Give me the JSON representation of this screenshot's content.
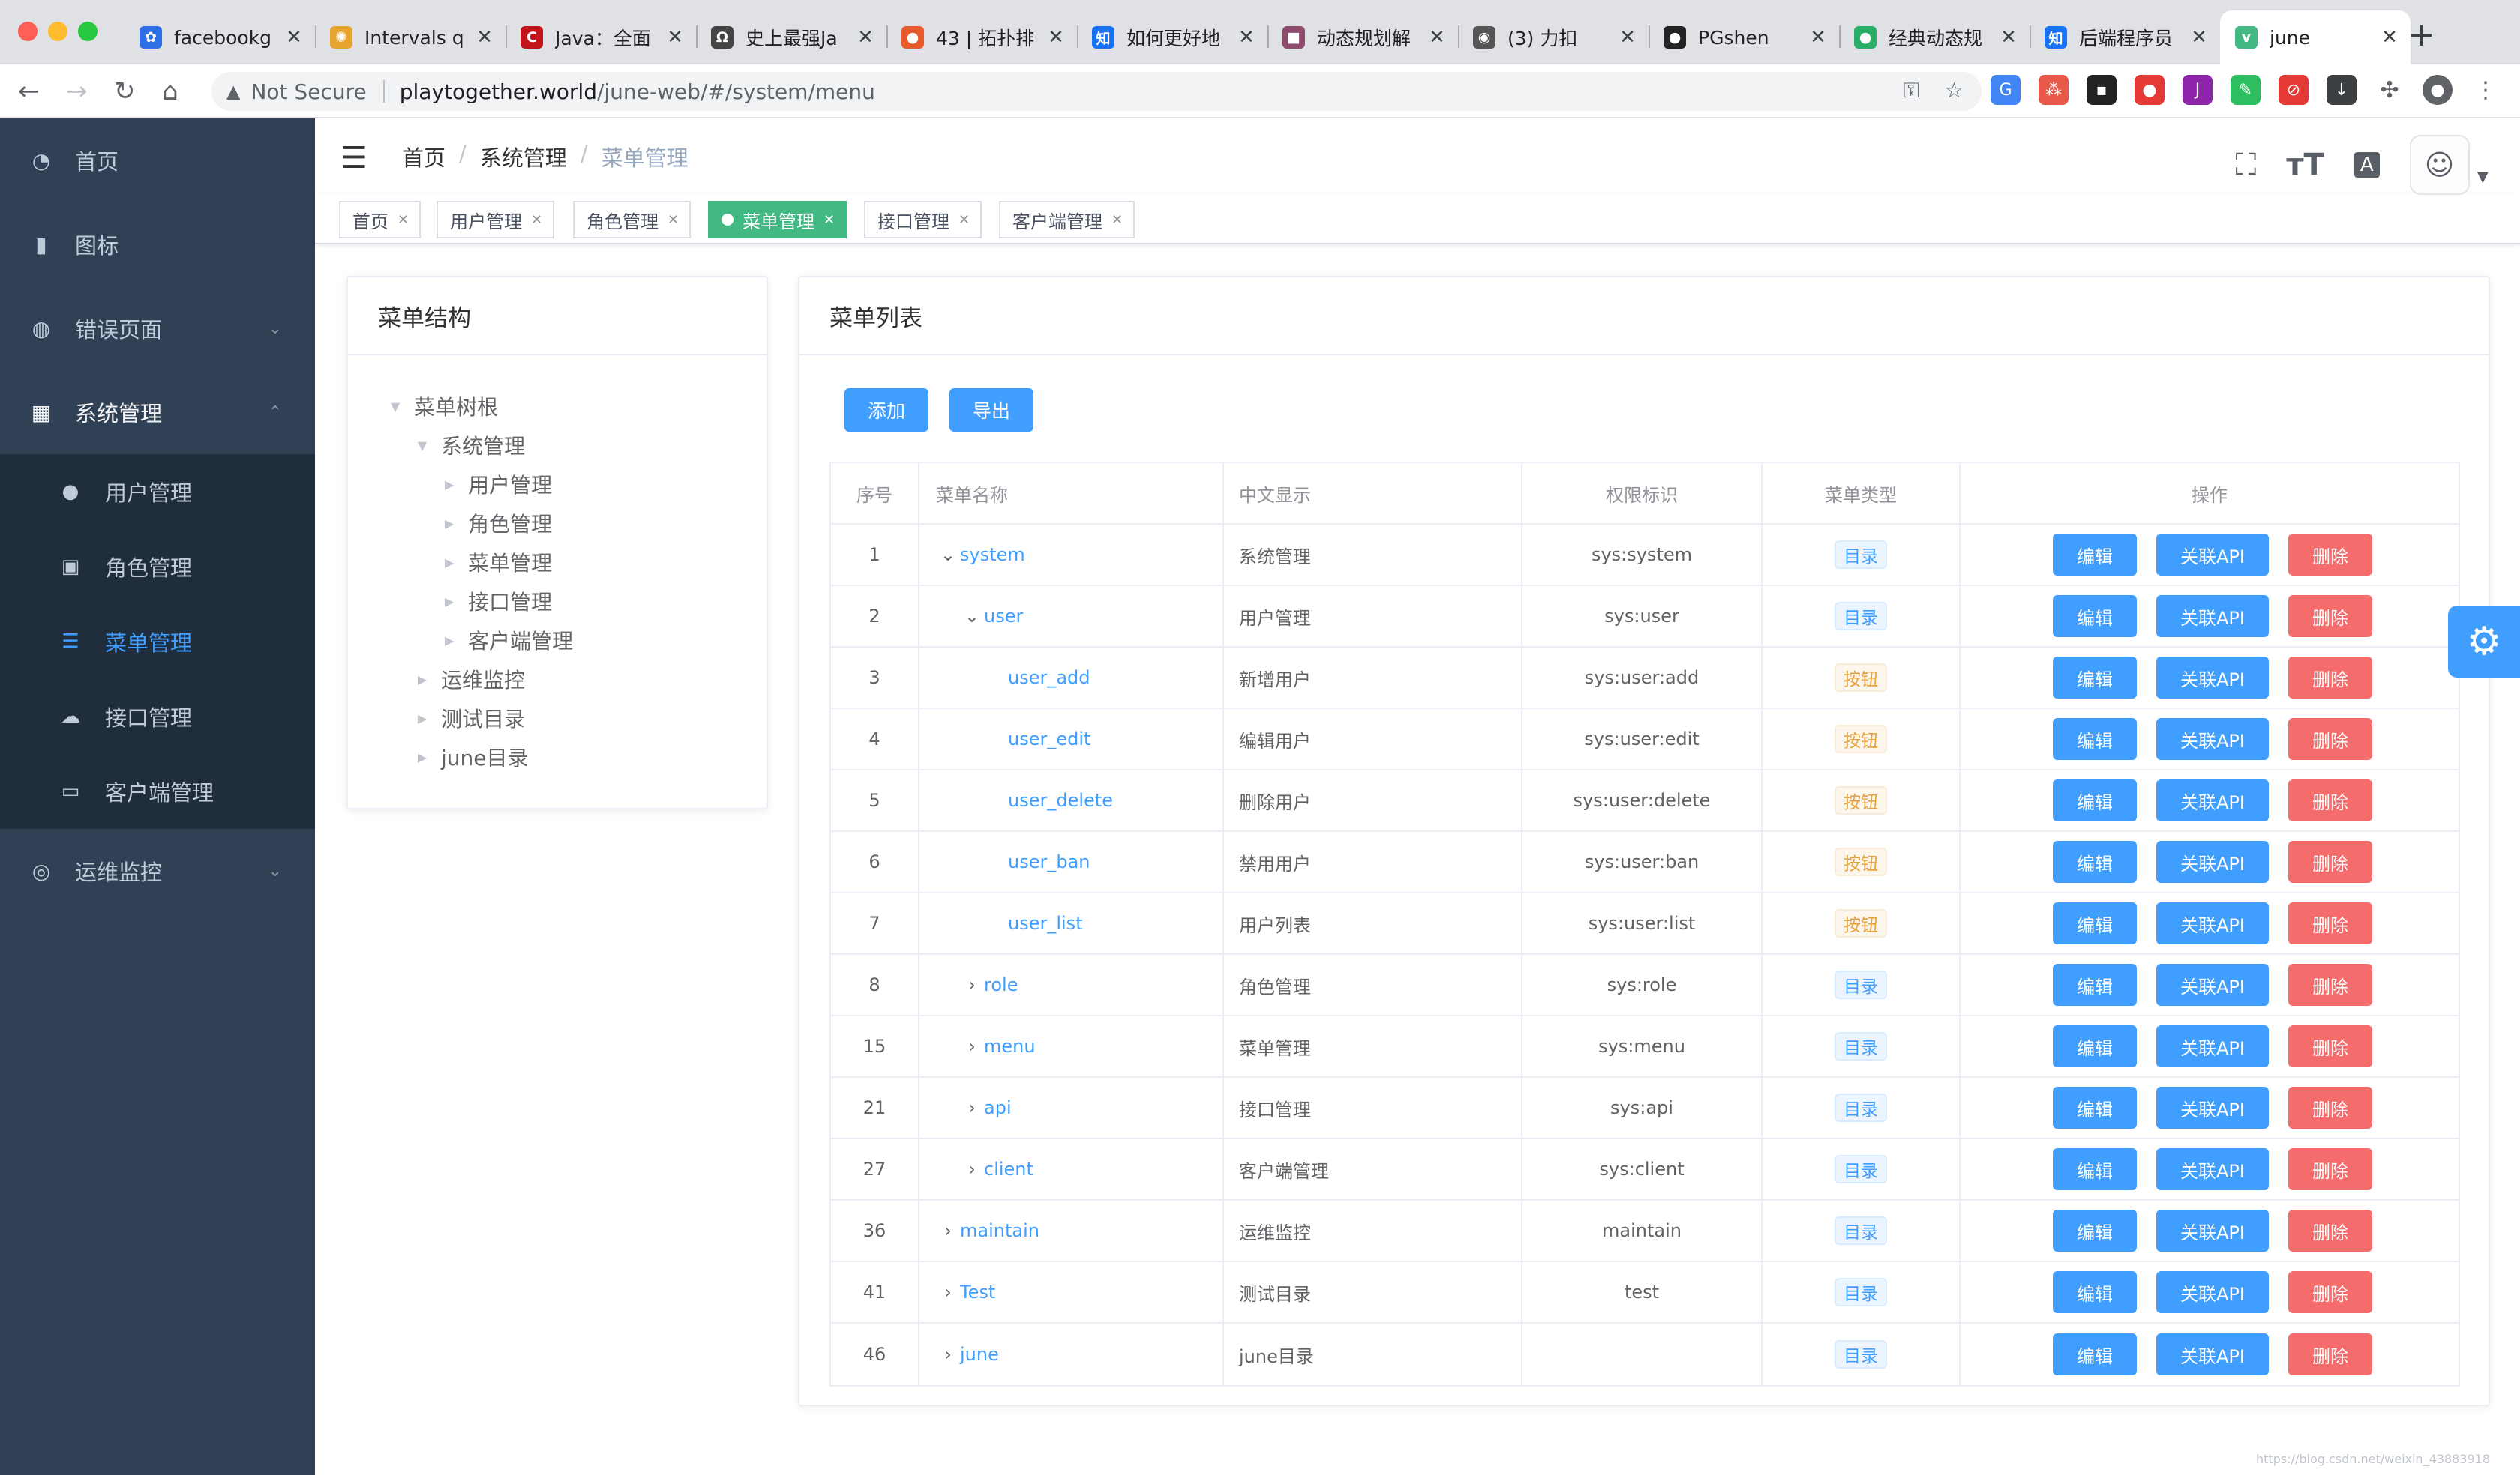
{
  "browser": {
    "tabs": [
      {
        "title": "facebookg",
        "icon": "paw-icon",
        "color": "#2f6fe4",
        "glyph": "✿"
      },
      {
        "title": "Intervals q",
        "icon": "sheets-icon",
        "color": "#e8a430",
        "glyph": "✺"
      },
      {
        "title": "Java：全面",
        "icon": "c-icon",
        "color": "#c4141b",
        "glyph": "C"
      },
      {
        "title": "史上最强Ja",
        "icon": "omega-icon",
        "color": "#444444",
        "glyph": "Ω"
      },
      {
        "title": "43 | 拓扑排",
        "icon": "geek-icon",
        "color": "#e85a2a",
        "glyph": "●"
      },
      {
        "title": "如何更好地",
        "icon": "zhihu-icon",
        "color": "#1772f6",
        "glyph": "知"
      },
      {
        "title": "动态规划解",
        "icon": "image-icon",
        "color": "#8e4a6b",
        "glyph": "■"
      },
      {
        "title": "(3) 力扣",
        "icon": "globe-icon",
        "color": "#555555",
        "glyph": "◉"
      },
      {
        "title": "PGshen",
        "icon": "github-icon",
        "color": "#222222",
        "glyph": "●"
      },
      {
        "title": "经典动态规",
        "icon": "wechat-icon",
        "color": "#2aae67",
        "glyph": "●"
      },
      {
        "title": "后端程序员",
        "icon": "zhihu-icon",
        "color": "#1772f6",
        "glyph": "知"
      },
      {
        "title": "june",
        "icon": "vue-icon",
        "color": "#42b983",
        "glyph": "v"
      }
    ],
    "not_secure": "Not Secure",
    "url_host": "playtogether.world",
    "url_path": "/june-web/#/system/menu"
  },
  "sidebar": {
    "items": [
      {
        "label": "首页",
        "icon": "dashboard-icon",
        "glyph": "◔"
      },
      {
        "label": "图标",
        "icon": "icon-icon",
        "glyph": "▮"
      },
      {
        "label": "错误页面",
        "icon": "bug-icon",
        "glyph": "◍",
        "arrow": "⌄"
      },
      {
        "label": "系统管理",
        "icon": "grid-icon",
        "glyph": "▦",
        "arrow": "⌃"
      }
    ],
    "sub_items": [
      {
        "label": "用户管理",
        "icon": "user-icon",
        "glyph": "●"
      },
      {
        "label": "角色管理",
        "icon": "role-icon",
        "glyph": "▣"
      },
      {
        "label": "菜单管理",
        "icon": "menu-icon",
        "glyph": "☰"
      },
      {
        "label": "接口管理",
        "icon": "cloud-icon",
        "glyph": "☁"
      },
      {
        "label": "客户端管理",
        "icon": "monitor-icon",
        "glyph": "▭"
      }
    ],
    "bottom_item": {
      "label": "运维监控",
      "icon": "lifebuoy-icon",
      "glyph": "◎",
      "arrow": "⌄"
    }
  },
  "header": {
    "breadcrumb": [
      "首页",
      "系统管理",
      "菜单管理"
    ]
  },
  "tagsview": [
    {
      "label": "首页",
      "active": false
    },
    {
      "label": "用户管理",
      "active": false
    },
    {
      "label": "角色管理",
      "active": false
    },
    {
      "label": "菜单管理",
      "active": true
    },
    {
      "label": "接口管理",
      "active": false
    },
    {
      "label": "客户端管理",
      "active": false
    }
  ],
  "tree_card": {
    "title": "菜单结构",
    "nodes": [
      {
        "label": "菜单树根",
        "level": 0,
        "expanded": true
      },
      {
        "label": "系统管理",
        "level": 1,
        "expanded": true
      },
      {
        "label": "用户管理",
        "level": 2,
        "expanded": false
      },
      {
        "label": "角色管理",
        "level": 2,
        "expanded": false
      },
      {
        "label": "菜单管理",
        "level": 2,
        "expanded": false
      },
      {
        "label": "接口管理",
        "level": 2,
        "expanded": false
      },
      {
        "label": "客户端管理",
        "level": 2,
        "expanded": false
      },
      {
        "label": "运维监控",
        "level": 1,
        "expanded": false
      },
      {
        "label": "测试目录",
        "level": 1,
        "expanded": false
      },
      {
        "label": "june目录",
        "level": 1,
        "expanded": false
      }
    ]
  },
  "list_card": {
    "title": "菜单列表",
    "add_label": "添加",
    "export_label": "导出",
    "columns": [
      "序号",
      "菜单名称",
      "中文显示",
      "权限标识",
      "菜单类型",
      "操作"
    ],
    "edit_label": "编辑",
    "api_label": "关联API",
    "delete_label": "删除",
    "rows": [
      {
        "id": "1",
        "name": "system",
        "indent": 0,
        "arrow": "⌄",
        "cn": "系统管理",
        "perm": "sys:system",
        "type": "目录",
        "kind": "dir"
      },
      {
        "id": "2",
        "name": "user",
        "indent": 1,
        "arrow": "⌄",
        "cn": "用户管理",
        "perm": "sys:user",
        "type": "目录",
        "kind": "dir"
      },
      {
        "id": "3",
        "name": "user_add",
        "indent": 2,
        "arrow": "",
        "cn": "新增用户",
        "perm": "sys:user:add",
        "type": "按钮",
        "kind": "btn"
      },
      {
        "id": "4",
        "name": "user_edit",
        "indent": 2,
        "arrow": "",
        "cn": "编辑用户",
        "perm": "sys:user:edit",
        "type": "按钮",
        "kind": "btn"
      },
      {
        "id": "5",
        "name": "user_delete",
        "indent": 2,
        "arrow": "",
        "cn": "删除用户",
        "perm": "sys:user:delete",
        "type": "按钮",
        "kind": "btn"
      },
      {
        "id": "6",
        "name": "user_ban",
        "indent": 2,
        "arrow": "",
        "cn": "禁用用户",
        "perm": "sys:user:ban",
        "type": "按钮",
        "kind": "btn"
      },
      {
        "id": "7",
        "name": "user_list",
        "indent": 2,
        "arrow": "",
        "cn": "用户列表",
        "perm": "sys:user:list",
        "type": "按钮",
        "kind": "btn"
      },
      {
        "id": "8",
        "name": "role",
        "indent": 1,
        "arrow": "›",
        "cn": "角色管理",
        "perm": "sys:role",
        "type": "目录",
        "kind": "dir"
      },
      {
        "id": "15",
        "name": "menu",
        "indent": 1,
        "arrow": "›",
        "cn": "菜单管理",
        "perm": "sys:menu",
        "type": "目录",
        "kind": "dir"
      },
      {
        "id": "21",
        "name": "api",
        "indent": 1,
        "arrow": "›",
        "cn": "接口管理",
        "perm": "sys:api",
        "type": "目录",
        "kind": "dir"
      },
      {
        "id": "27",
        "name": "client",
        "indent": 1,
        "arrow": "›",
        "cn": "客户端管理",
        "perm": "sys:client",
        "type": "目录",
        "kind": "dir"
      },
      {
        "id": "36",
        "name": "maintain",
        "indent": 0,
        "arrow": "›",
        "cn": "运维监控",
        "perm": "maintain",
        "type": "目录",
        "kind": "dir"
      },
      {
        "id": "41",
        "name": "Test",
        "indent": 0,
        "arrow": "›",
        "cn": "测试目录",
        "perm": "test",
        "type": "目录",
        "kind": "dir"
      },
      {
        "id": "46",
        "name": "june",
        "indent": 0,
        "arrow": "›",
        "cn": "june目录",
        "perm": "",
        "type": "目录",
        "kind": "dir"
      }
    ]
  },
  "watermark": "https://blog.csdn.net/weixin_43883918"
}
